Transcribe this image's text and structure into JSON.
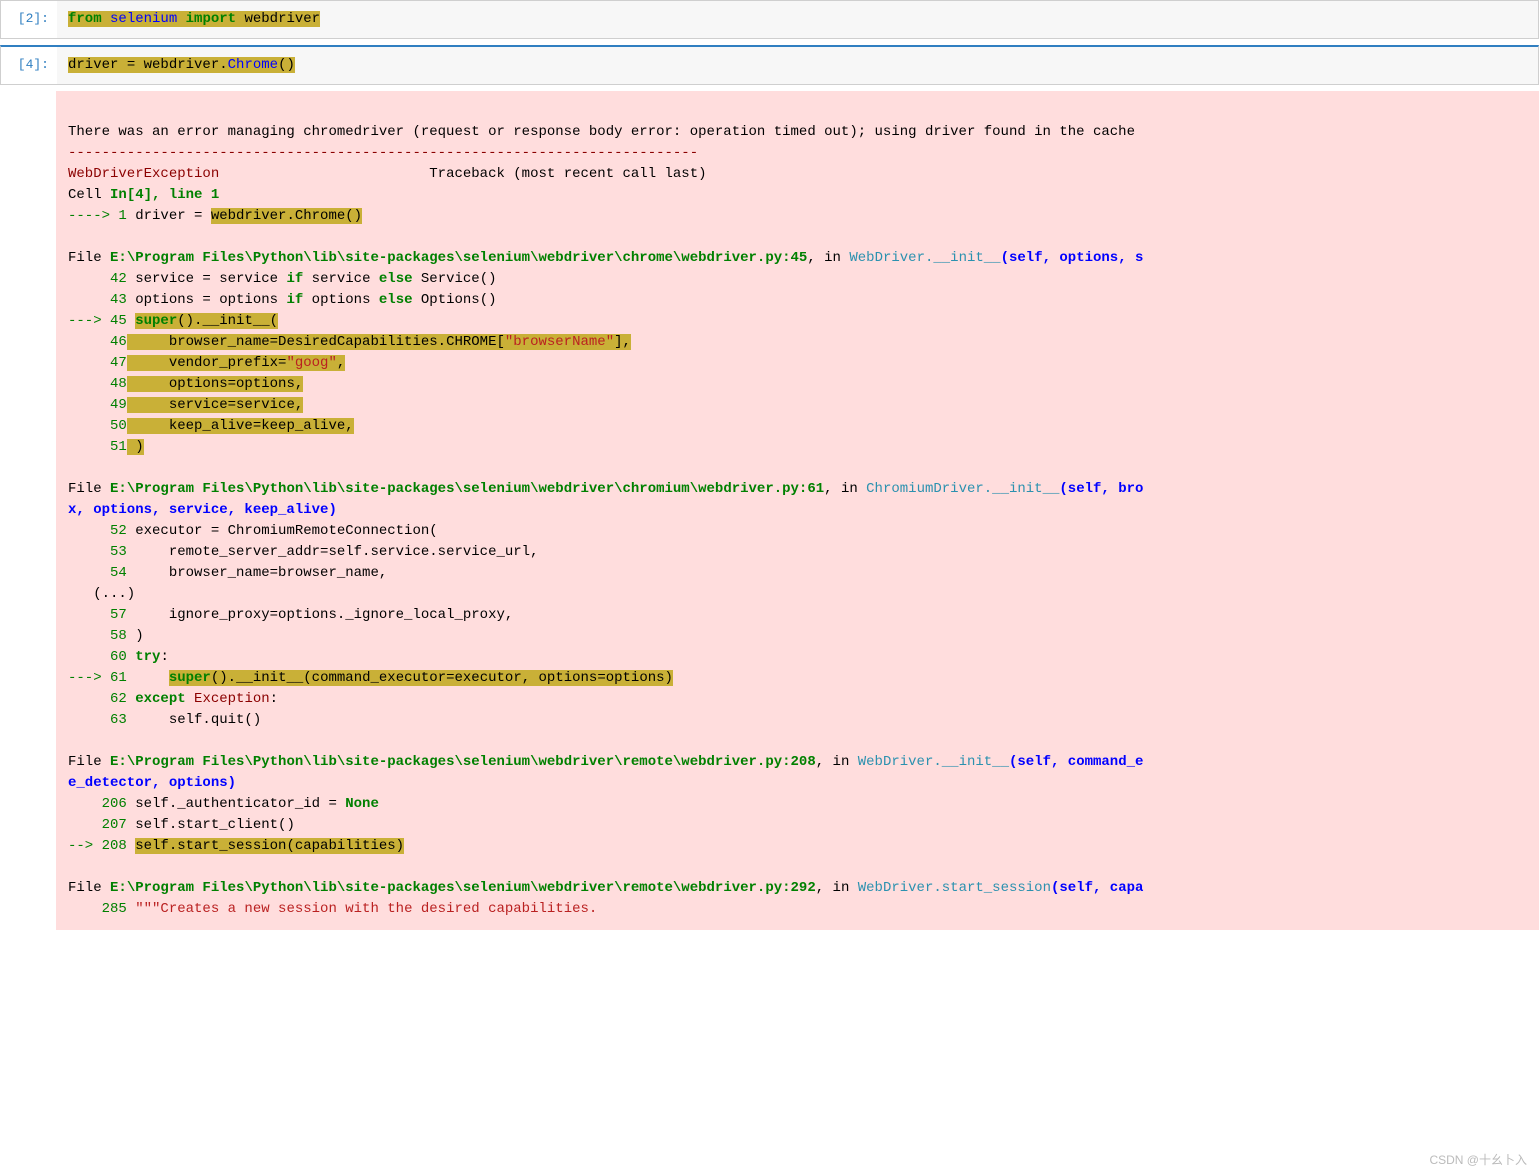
{
  "cells": {
    "cell1": {
      "prompt": "[2]:"
    },
    "cell2": {
      "prompt": "[4]:"
    }
  },
  "code1": {
    "kfrom": "from",
    "mod": "selenium",
    "kimport": "import",
    "name": "webdriver"
  },
  "code2": {
    "lhs": "driver ",
    "eq": "= ",
    "mod": "webdriver",
    "dot": ".",
    "fn": "Chrome",
    "paren": "()"
  },
  "err": {
    "intro": "There was an error managing chromedriver (request or response body error: operation timed out); using driver found in the cache",
    "dashes": "---------------------------------------------------------------------------",
    "excname": "WebDriverException",
    "tbhead": "                         Traceback (most recent call last)",
    "cellref": "Cell ",
    "inref": "In[4], line 1",
    "arrow1": "----> 1",
    "line1a": " driver = ",
    "line1b": "webdriver.Chrome()",
    "file1_lbl": "File ",
    "file1_path": "E:\\Program Files\\Python\\lib\\site-packages\\selenium\\webdriver\\chrome\\webdriver.py:45",
    "file1_in": ", in ",
    "file1_fn": "WebDriver.__init__",
    "file1_args": "(self, options, s",
    "f1_42a": "     42",
    "f1_42b": " service = service ",
    "f1_42c": "if",
    "f1_42d": " service ",
    "f1_42e": "else",
    "f1_42f": " Service()",
    "f1_43a": "     43",
    "f1_43b": " options = options ",
    "f1_43c": "if",
    "f1_43d": " options ",
    "f1_43e": "else",
    "f1_43f": " Options()",
    "f1_45arrow": "---> 45",
    "f1_45b": " ",
    "f1_45c": "super",
    "f1_45d": "().",
    "f1_45e": "__init__",
    "f1_45f": "(",
    "f1_46a": "     46",
    "f1_46b": "     browser_name=DesiredCapabilities.CHROME[",
    "f1_46c": "\"browserName\"",
    "f1_46d": "],",
    "f1_47a": "     47",
    "f1_47b": "     vendor_prefix=",
    "f1_47c": "\"goog\"",
    "f1_47d": ",",
    "f1_48a": "     48",
    "f1_48b": "     options=options,",
    "f1_49a": "     49",
    "f1_49b": "     service=service,",
    "f1_50a": "     50",
    "f1_50b": "     keep_alive=keep_alive,",
    "f1_51a": "     51",
    "f1_51b": " )",
    "file2_lbl": "File ",
    "file2_path": "E:\\Program Files\\Python\\lib\\site-packages\\selenium\\webdriver\\chromium\\webdriver.py:61",
    "file2_in": ", in ",
    "file2_fn": "ChromiumDriver.__init__",
    "file2_args": "(self, bro",
    "file2_args2": "x, options, service, keep_alive)",
    "f2_52a": "     52",
    "f2_52b": " executor = ChromiumRemoteConnection(",
    "f2_53a": "     53",
    "f2_53b": "     remote_server_addr=self.service.service_url,",
    "f2_54a": "     54",
    "f2_54b": "     browser_name=browser_name,",
    "f2_elps": "   (...)",
    "f2_57a": "     57",
    "f2_57b": "     ignore_proxy=options._ignore_local_proxy,",
    "f2_58a": "     58",
    "f2_58b": " )",
    "f2_60a": "     60",
    "f2_60b": " ",
    "f2_60c": "try",
    "f2_60d": ":",
    "f2_61arrow": "---> 61",
    "f2_61b": "     ",
    "f2_61c": "super",
    "f2_61d": "().",
    "f2_61e": "__init__",
    "f2_61f": "(command_executor=executor, options=options)",
    "f2_62a": "     62",
    "f2_62b": " ",
    "f2_62c": "except",
    "f2_62d": " ",
    "f2_62e": "Exception",
    "f2_62f": ":",
    "f2_63a": "     63",
    "f2_63b": "     self.quit()",
    "file3_lbl": "File ",
    "file3_path": "E:\\Program Files\\Python\\lib\\site-packages\\selenium\\webdriver\\remote\\webdriver.py:208",
    "file3_in": ", in ",
    "file3_fn": "WebDriver.__init__",
    "file3_args": "(self, command_e",
    "file3_args2": "e_detector, options)",
    "f3_206a": "    206",
    "f3_206b": " self._authenticator_id = ",
    "f3_206c": "None",
    "f3_207a": "    207",
    "f3_207b": " self.start_client()",
    "f3_208arrow": "--> 208",
    "f3_208b": " ",
    "f3_208c": "self.start_session(capabilities)",
    "file4_lbl": "File ",
    "file4_path": "E:\\Program Files\\Python\\lib\\site-packages\\selenium\\webdriver\\remote\\webdriver.py:292",
    "file4_in": ", in ",
    "file4_fn": "WebDriver.start_session",
    "file4_args": "(self, capa",
    "f4_285a": "    285",
    "f4_285b": " ",
    "f4_285c": "\"\"\"Creates a new session with the desired capabilities."
  },
  "watermark": "CSDN @十幺卜入"
}
